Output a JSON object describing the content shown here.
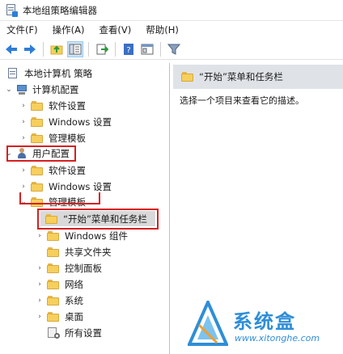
{
  "window": {
    "title": "本地组策略编辑器"
  },
  "menu": [
    "文件(F)",
    "操作(A)",
    "查看(V)",
    "帮助(H)"
  ],
  "toolbar": {
    "icons": [
      "back-arrow-icon",
      "forward-arrow-icon",
      "up-folder-icon",
      "show-tree-icon",
      "export-list-icon",
      "help-icon",
      "properties-icon",
      "filter-icon"
    ]
  },
  "tree": {
    "root": "本地计算机 策略",
    "computer_config": "计算机配置",
    "cc_software": "软件设置",
    "cc_windows": "Windows 设置",
    "cc_admin": "管理模板",
    "user_config": "用户配置",
    "uc_software": "软件设置",
    "uc_windows": "Windows 设置",
    "uc_admin": "管理模板",
    "start_menu": "“开始”菜单和任务栏",
    "win_components": "Windows 组件",
    "shared_folders": "共享文件夹",
    "control_panel": "控制面板",
    "network": "网络",
    "system": "系统",
    "desktop": "桌面",
    "all_settings": "所有设置"
  },
  "detail": {
    "header": "“开始”菜单和任务栏",
    "description": "选择一个项目来查看它的描述。"
  },
  "watermark": {
    "name": "系统盒",
    "url": "www.xitonghe.com"
  },
  "colors": {
    "highlight_box": "#d62020",
    "selection": "#d9d9d9",
    "detail_header": "#dfe3e8",
    "watermark": "#2e8ed8"
  }
}
